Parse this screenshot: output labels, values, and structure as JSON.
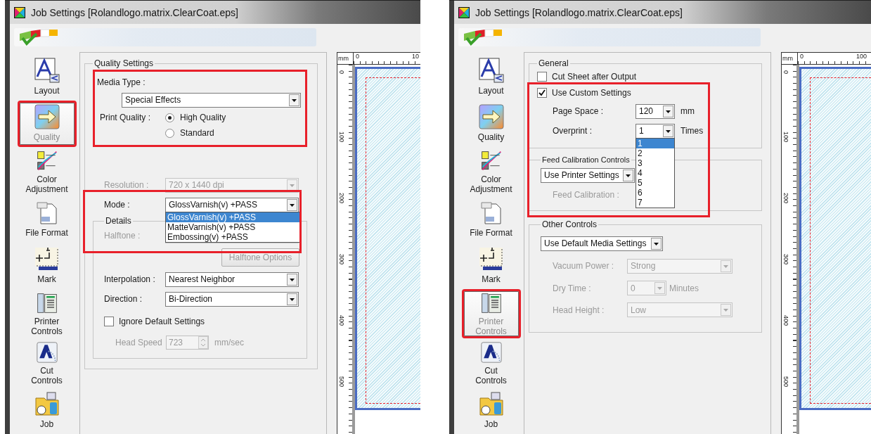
{
  "windows": [
    {
      "title": "Job Settings [Rolandlogo.matrix.ClearCoat.eps]",
      "sidebar": [
        {
          "label": "Layout",
          "selected": false,
          "highlighted": false
        },
        {
          "label": "Quality",
          "selected": true,
          "highlighted": true
        },
        {
          "label": "Color\nAdjustment",
          "selected": false,
          "highlighted": false
        },
        {
          "label": "File Format",
          "selected": false,
          "highlighted": false
        },
        {
          "label": "Mark",
          "selected": false,
          "highlighted": false
        },
        {
          "label": "Printer\nControls",
          "selected": false,
          "highlighted": false
        },
        {
          "label": "Cut\nControls",
          "selected": false,
          "highlighted": false
        },
        {
          "label": "Job",
          "selected": false,
          "highlighted": false
        }
      ],
      "panel": {
        "kind": "quality",
        "title": "Quality Settings",
        "media_section": {
          "highlighted": true,
          "media_type": {
            "label": "Media Type :",
            "value": "Special Effects"
          },
          "print_quality": {
            "label": "Print Quality :",
            "options": [
              {
                "label": "High Quality",
                "selected": true
              },
              {
                "label": "Standard",
                "selected": false
              }
            ]
          }
        },
        "resolution": {
          "label": "Resolution :",
          "value": "720 x 1440 dpi",
          "disabled": true
        },
        "mode": {
          "label": "Mode :",
          "value": "GlossVarnish(v) +PASS",
          "highlighted": true,
          "options": [
            {
              "label": "GlossVarnish(v) +PASS",
              "selected": true
            },
            {
              "label": "MatteVarnish(v) +PASS",
              "selected": false
            },
            {
              "label": "Embossing(v) +PASS",
              "selected": false
            }
          ]
        },
        "details": {
          "title": "Details",
          "halftone": {
            "label": "Halftone :",
            "disabled": true
          },
          "halftone_button": {
            "label": "Halftone Options",
            "disabled": true
          },
          "interpolation": {
            "label": "Interpolation :",
            "value": "Nearest Neighbor",
            "disabled": false
          },
          "direction": {
            "label": "Direction :",
            "value": "Bi-Direction",
            "disabled": false
          },
          "ignore_defaults": {
            "label": "Ignore Default Settings",
            "checked": false
          },
          "head_speed": {
            "label": "Head Speed",
            "value": "723",
            "unit": "mm/sec",
            "disabled": true
          }
        }
      },
      "preview": {
        "unit": "mm",
        "x_labels": [
          "0",
          "10"
        ],
        "y_labels": [
          "0",
          "100",
          "200",
          "300",
          "400",
          "500"
        ]
      }
    },
    {
      "title": "Job Settings [Rolandlogo.matrix.ClearCoat.eps]",
      "sidebar": [
        {
          "label": "Layout",
          "selected": false,
          "highlighted": false
        },
        {
          "label": "Quality",
          "selected": false,
          "highlighted": false
        },
        {
          "label": "Color\nAdjustment",
          "selected": false,
          "highlighted": false
        },
        {
          "label": "File Format",
          "selected": false,
          "highlighted": false
        },
        {
          "label": "Mark",
          "selected": false,
          "highlighted": false
        },
        {
          "label": "Printer\nControls",
          "selected": true,
          "highlighted": true
        },
        {
          "label": "Cut\nControls",
          "selected": false,
          "highlighted": false
        },
        {
          "label": "Job",
          "selected": false,
          "highlighted": false
        }
      ],
      "panel": {
        "kind": "printer",
        "general": {
          "title": "General",
          "cut_sheet": {
            "label": "Cut Sheet after Output",
            "checked": false
          },
          "custom": {
            "highlighted": true,
            "checkbox": {
              "label": "Use Custom Settings",
              "checked": true
            },
            "page_space": {
              "label": "Page Space :",
              "value": "120",
              "unit": "mm"
            },
            "overprint": {
              "label": "Overprint :",
              "value": "1",
              "unit": "Times",
              "options": [
                {
                  "label": "1",
                  "selected": true
                },
                {
                  "label": "2",
                  "selected": false
                },
                {
                  "label": "3",
                  "selected": false
                },
                {
                  "label": "4",
                  "selected": false
                },
                {
                  "label": "5",
                  "selected": false
                },
                {
                  "label": "6",
                  "selected": false
                },
                {
                  "label": "7",
                  "selected": false
                }
              ]
            }
          }
        },
        "feed": {
          "title": "Feed Calibration Controls",
          "value": "Use Printer Settings",
          "calibration": {
            "label": "Feed Calibration :",
            "disabled": true
          }
        },
        "other": {
          "title": "Other Controls",
          "value": "Use Default Media Settings",
          "rows": [
            {
              "label": "Vacuum Power :",
              "value": "Strong",
              "disabled": true
            },
            {
              "label": "Dry Time :",
              "value": "0",
              "unit": "Minutes",
              "disabled": true
            },
            {
              "label": "Head Height :",
              "value": "Low",
              "disabled": true
            }
          ]
        }
      },
      "preview": {
        "unit": "mm",
        "x_labels": [
          "0",
          "100"
        ],
        "y_labels": [
          "0",
          "100",
          "200",
          "300",
          "400",
          "500"
        ]
      }
    }
  ]
}
